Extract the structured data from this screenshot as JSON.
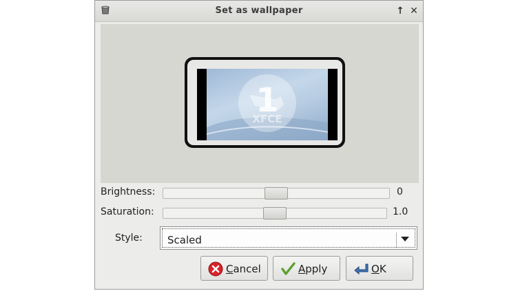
{
  "window": {
    "title": "Set as wallpaper"
  },
  "titlebar_buttons": {
    "maximize_glyph": "↑",
    "close_glyph": "✕"
  },
  "preview": {
    "workspace_number": "1",
    "wallpaper_text": "XFCE"
  },
  "brightness": {
    "label": "Brightness:",
    "value_text": "0",
    "level": 0.5
  },
  "saturation": {
    "label": "Saturation:",
    "value_text": "1.0",
    "level": 0.5
  },
  "style": {
    "label": "Style:",
    "selected": "Scaled"
  },
  "buttons": {
    "cancel": {
      "mnemonic": "C",
      "rest": "ancel",
      "icon": "cancel-icon",
      "icon_color": "#d8232a"
    },
    "apply": {
      "mnemonic": "A",
      "rest": "pply",
      "icon": "checkmark-icon",
      "icon_color": "#5aa02c"
    },
    "ok": {
      "mnemonic": "O",
      "rest": "K",
      "icon": "return-arrow-icon",
      "icon_color": "#3f73b5"
    }
  }
}
